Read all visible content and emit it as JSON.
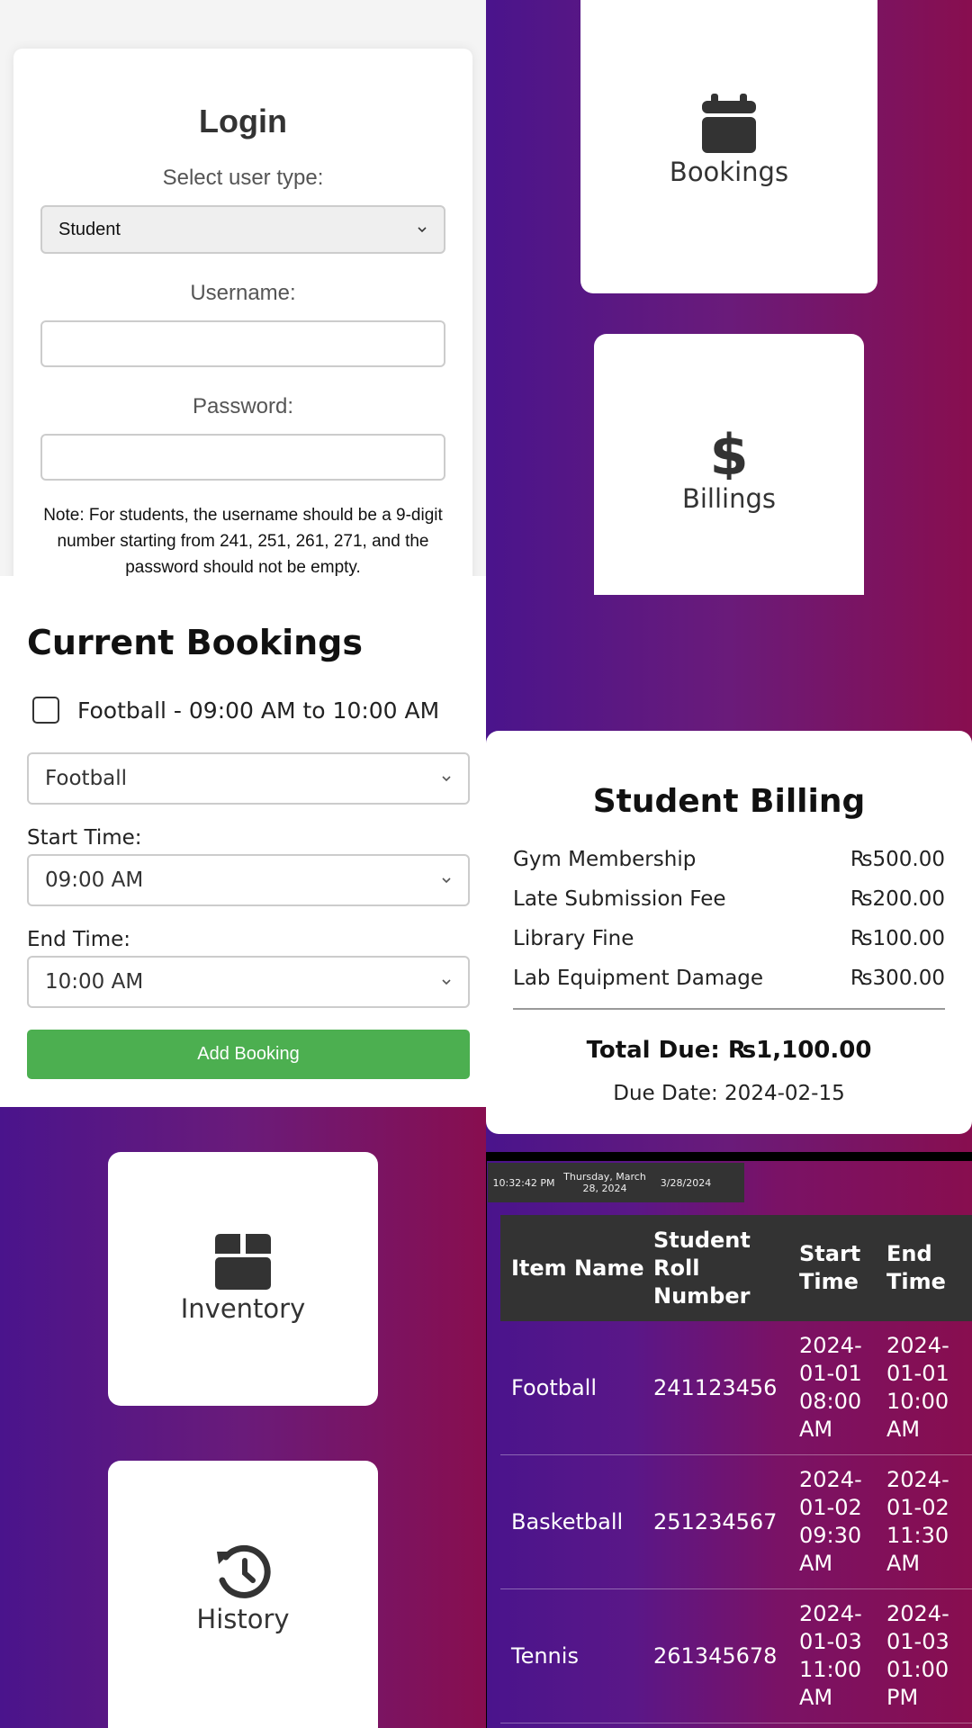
{
  "login": {
    "title": "Login",
    "user_type_label": "Select user type:",
    "user_type_value": "Student",
    "username_label": "Username:",
    "password_label": "Password:",
    "note": "Note: For students, the username should be a 9-digit number starting from 241, 251, 261, 271, and the password should not be empty."
  },
  "tiles": {
    "bookings": "Bookings",
    "billings": "Billings",
    "inventory": "Inventory",
    "history": "History"
  },
  "current_bookings": {
    "title": "Current Bookings",
    "existing": "Football - 09:00 AM to 10:00 AM",
    "sport_value": "Football",
    "start_label": "Start Time:",
    "start_value": "09:00 AM",
    "end_label": "End Time:",
    "end_value": "10:00 AM",
    "add_button": "Add Booking"
  },
  "billing": {
    "title": "Student Billing",
    "items": [
      {
        "name": "Gym Membership",
        "amount": "₨500.00"
      },
      {
        "name": "Late Submission Fee",
        "amount": "₨200.00"
      },
      {
        "name": "Library Fine",
        "amount": "₨100.00"
      },
      {
        "name": "Lab Equipment Damage",
        "amount": "₨300.00"
      }
    ],
    "total": "Total Due: ₨1,100.00",
    "due_date": "Due Date: 2024-02-15"
  },
  "clock": {
    "time": "10:32:42 PM",
    "date_long": "Thursday, March 28, 2024",
    "date_short": "3/28/2024"
  },
  "history_table": {
    "headers": [
      "Item Name",
      "Student Roll Number",
      "Start Time",
      "End Time"
    ],
    "rows": [
      [
        "Football",
        "241123456",
        "2024-01-01 08:00 AM",
        "2024-01-01 10:00 AM"
      ],
      [
        "Basketball",
        "251234567",
        "2024-01-02 09:30 AM",
        "2024-01-02 11:30 AM"
      ],
      [
        "Tennis",
        "261345678",
        "2024-01-03 11:00 AM",
        "2024-01-03 01:00 PM"
      ]
    ]
  },
  "colors": {
    "gradient_start": "#4a148c",
    "gradient_end": "#880e4f",
    "add_button": "#4caf50",
    "table_header": "#333333"
  }
}
